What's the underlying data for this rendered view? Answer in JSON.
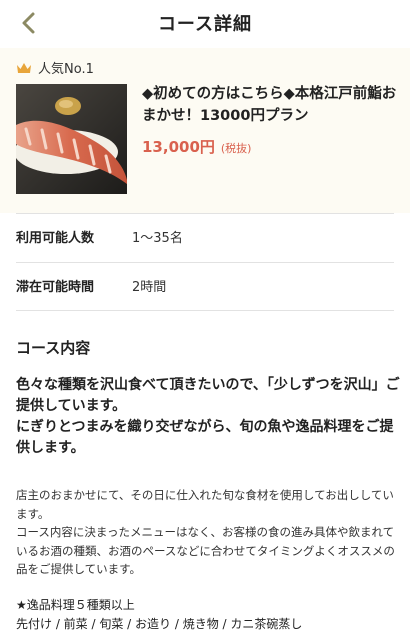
{
  "header": {
    "title": "コース詳細",
    "back_icon": "chevron-left-icon"
  },
  "plan": {
    "rank_label": "人気No.1",
    "rank_icon": "crown-icon",
    "title": "◆初めての方はこちら◆本格江戸前鮨おまかせ！13000円プラン",
    "price": "13,000円",
    "tax_note": "(税抜)"
  },
  "info": {
    "rows": [
      {
        "label": "利用可能人数",
        "value": "1〜35名"
      },
      {
        "label": "滞在可能時間",
        "value": "2時間"
      }
    ]
  },
  "course": {
    "heading": "コース内容",
    "lead": "色々な種類を沢山食べて頂きたいので、「少しずつを沢山」ご提供しています。\nにぎりとつまみを織り交ぜながら、旬の魚や逸品料理をご提供します。",
    "body": "店主のおまかせにて、その日に仕入れた旬な食材を使用してお出ししています。\nコース内容に決まったメニューはなく、お客様の食の進み具体や飲まれているお酒の種類、お酒のペースなどに合わせてタイミングよくオススメの品をご提供しています。",
    "items_heading": "★逸品料理５種類以上",
    "items": "先付け / 前菜 / 旬菜 / お造り / 焼き物 / カニ茶碗蒸し"
  },
  "colors": {
    "accent": "#d9614e",
    "back": "#8c8a63",
    "crown": "#e8a53a",
    "panel": "#fdfbf3"
  }
}
